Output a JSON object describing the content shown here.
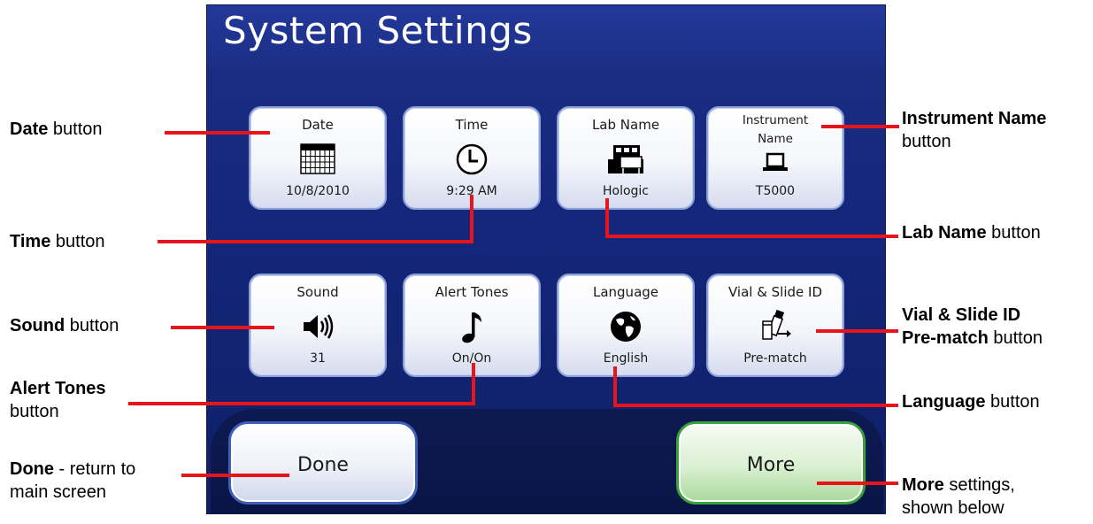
{
  "screen": {
    "title": "System Settings",
    "tiles": [
      {
        "label": "Date",
        "value": "10/8/2010",
        "icon": "calendar-icon"
      },
      {
        "label": "Time",
        "value": "9:29 AM",
        "icon": "clock-icon"
      },
      {
        "label": "Lab Name",
        "value": "Hologic",
        "icon": "lab-icon"
      },
      {
        "label_line1": "Instrument",
        "label_line2": "Name",
        "value": "T5000",
        "icon": "computer-icon"
      },
      {
        "label": "Sound",
        "value": "31",
        "icon": "speaker-icon"
      },
      {
        "label": "Alert Tones",
        "value": "On/On",
        "icon": "music-note-icon"
      },
      {
        "label": "Language",
        "value": "English",
        "icon": "globe-icon"
      },
      {
        "label": "Vial & Slide ID",
        "value": "Pre-match",
        "icon": "vial-slide-icon"
      }
    ],
    "done_label": "Done",
    "more_label": "More"
  },
  "callouts": {
    "date": {
      "bold": "Date",
      "rest": " button"
    },
    "time": {
      "bold": "Time",
      "rest": " button"
    },
    "sound": {
      "bold": "Sound",
      "rest": " button"
    },
    "alert_tones": {
      "bold": "Alert Tones",
      "rest": "button"
    },
    "done": {
      "bold": "Done",
      "rest1": " - return to",
      "rest2": "main screen"
    },
    "instrument_name": {
      "bold": "Instrument Name",
      "rest": "button"
    },
    "lab_name": {
      "bold": "Lab Name",
      "rest": " button"
    },
    "vial_slide": {
      "bold1": "Vial & Slide ID",
      "bold2": "Pre-match",
      "rest": " button"
    },
    "language": {
      "bold": "Language",
      "rest": " button"
    },
    "more": {
      "bold": "More",
      "rest1": " settings,",
      "rest2": "shown below"
    }
  },
  "colors": {
    "screen_bg": "#14267a",
    "callout_line": "#e8141c",
    "done_border": "#3f5fb8",
    "more_border": "#3aa23a"
  }
}
